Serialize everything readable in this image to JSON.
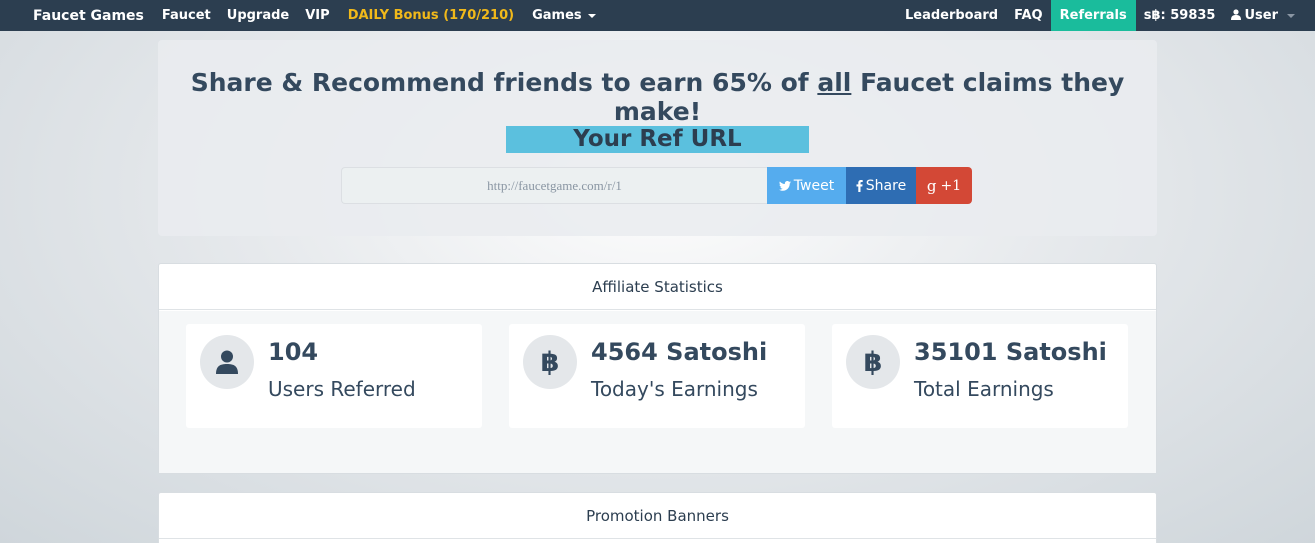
{
  "navbar": {
    "brand": "Faucet Games",
    "left_links": [
      "Faucet",
      "Upgrade",
      "VIP"
    ],
    "bonus": "DAILY Bonus (170/210)",
    "games": "Games",
    "right_links": [
      "Leaderboard",
      "FAQ"
    ],
    "referrals": "Referrals",
    "balance": "s฿: 59835",
    "user": "User"
  },
  "hero": {
    "title_before": "Share & Recommend friends to earn 65% of ",
    "title_underline": "all",
    "title_after": " Faucet claims they make!",
    "ref_label": "Your Ref URL",
    "ref_url": "http://faucetgame.com/r/1",
    "buttons": {
      "tweet": "Tweet",
      "share": "Share",
      "gplus": "+1"
    }
  },
  "stats": {
    "heading": "Affiliate Statistics",
    "cards": [
      {
        "icon": "user-icon",
        "value": "104",
        "label": "Users Referred"
      },
      {
        "icon": "bitcoin-icon",
        "value": "4564 Satoshi",
        "label": "Today's Earnings"
      },
      {
        "icon": "bitcoin-icon",
        "value": "35101 Satoshi",
        "label": "Total Earnings"
      }
    ]
  },
  "promo": {
    "heading": "Promotion Banners"
  },
  "colors": {
    "navbar": "#2c3e50",
    "accent": "#1abc9c",
    "bonus": "#f1b91a",
    "ref_label": "#5bc0de",
    "tweet": "#55acee",
    "share": "#2e6db3",
    "gplus": "#d34836"
  }
}
